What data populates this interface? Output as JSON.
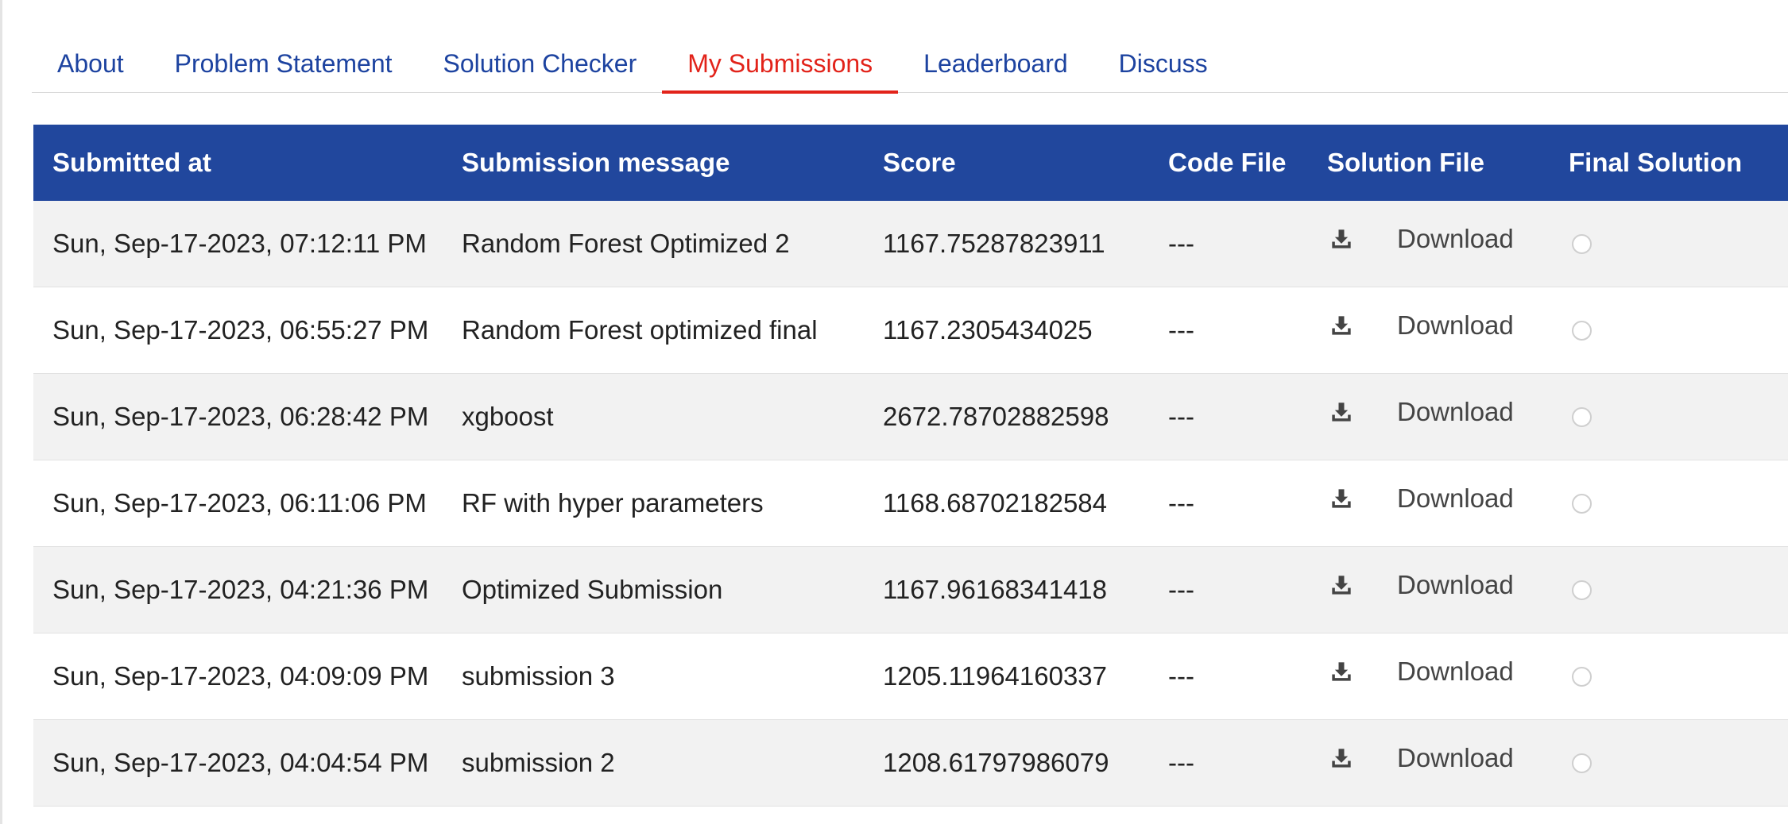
{
  "tabs": [
    {
      "label": "About"
    },
    {
      "label": "Problem Statement"
    },
    {
      "label": "Solution Checker"
    },
    {
      "label": "My Submissions",
      "active": true
    },
    {
      "label": "Leaderboard"
    },
    {
      "label": "Discuss"
    }
  ],
  "table": {
    "headers": [
      "Submitted at",
      "Submission message",
      "Score",
      "Code File",
      "Solution File",
      "Final Solution"
    ],
    "download_icon": "download-icon",
    "rows": [
      {
        "submitted_at": "Sun, Sep-17-2023, 07:12:11 PM",
        "message": "Random Forest Optimized 2",
        "score": "1167.75287823911",
        "code_file": "---",
        "solution_file": "Download",
        "final": false
      },
      {
        "submitted_at": "Sun, Sep-17-2023, 06:55:27 PM",
        "message": "Random Forest optimized final",
        "score": "1167.2305434025",
        "code_file": "---",
        "solution_file": "Download",
        "final": false
      },
      {
        "submitted_at": "Sun, Sep-17-2023, 06:28:42 PM",
        "message": "xgboost",
        "score": "2672.78702882598",
        "code_file": "---",
        "solution_file": "Download",
        "final": false
      },
      {
        "submitted_at": "Sun, Sep-17-2023, 06:11:06 PM",
        "message": "RF with hyper parameters",
        "score": "1168.68702182584",
        "code_file": "---",
        "solution_file": "Download",
        "final": false
      },
      {
        "submitted_at": "Sun, Sep-17-2023, 04:21:36 PM",
        "message": "Optimized Submission",
        "score": "1167.96168341418",
        "code_file": "---",
        "solution_file": "Download",
        "final": false
      },
      {
        "submitted_at": "Sun, Sep-17-2023, 04:09:09 PM",
        "message": "submission 3",
        "score": "1205.11964160337",
        "code_file": "---",
        "solution_file": "Download",
        "final": false
      },
      {
        "submitted_at": "Sun, Sep-17-2023, 04:04:54 PM",
        "message": "submission 2",
        "score": "1208.61797986079",
        "code_file": "---",
        "solution_file": "Download",
        "final": false
      }
    ]
  },
  "colors": {
    "tab_text": "#1d43a0",
    "tab_active": "#e2231a",
    "header_bg": "#21479d",
    "row_alt_bg": "#f2f2f2"
  }
}
